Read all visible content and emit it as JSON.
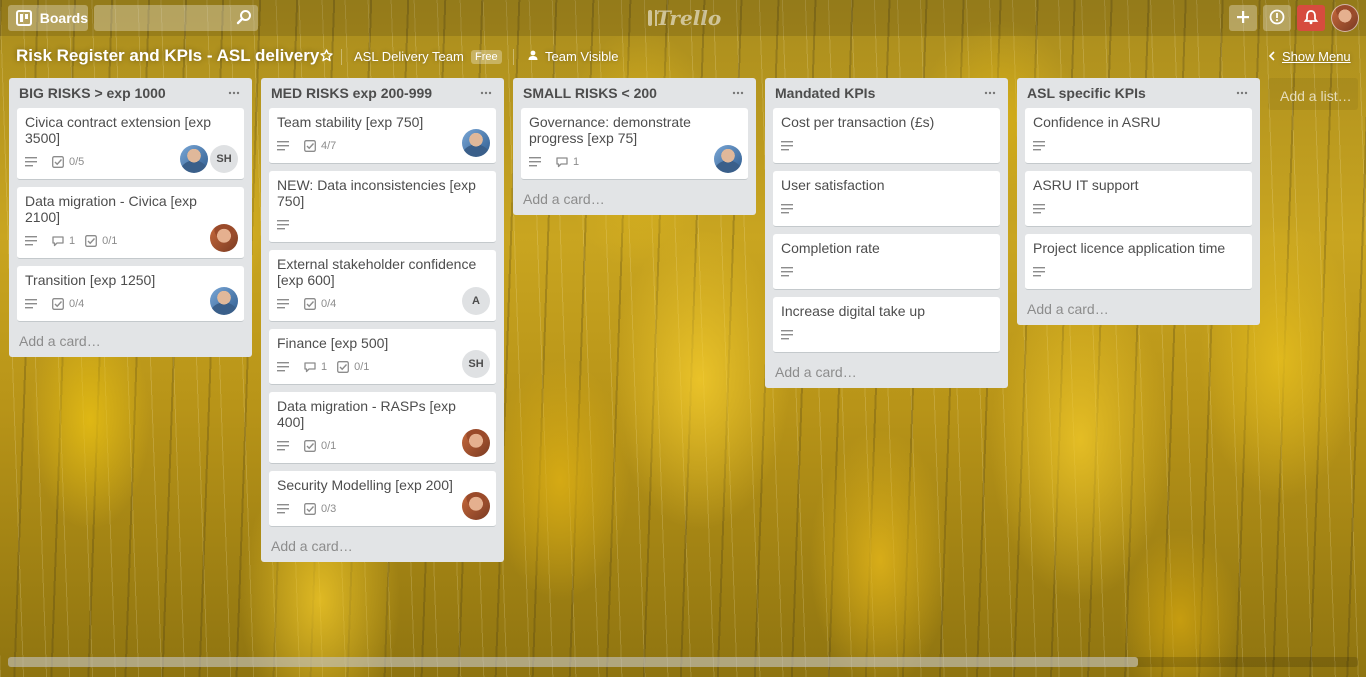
{
  "header": {
    "boards_label": "Boards",
    "logo_text": "Trello"
  },
  "board": {
    "title": "Risk Register and KPIs - ASL delivery",
    "team": "ASL Delivery Team",
    "team_badge": "Free",
    "visibility": "Team Visible",
    "show_menu": "Show Menu",
    "add_list": "Add a list…"
  },
  "lists": [
    {
      "title": "BIG RISKS > exp 1000",
      "add_card": "Add a card…",
      "cards": [
        {
          "title": "Civica contract extension [exp 3500]",
          "checklist": "0/5"
        },
        {
          "title": "Data migration - Civica [exp 2100]",
          "comments": "1",
          "checklist": "0/1"
        },
        {
          "title": "Transition [exp 1250]",
          "checklist": "0/4"
        }
      ]
    },
    {
      "title": "MED RISKS exp 200-999",
      "add_card": "Add a card…",
      "cards": [
        {
          "title": "Team stability [exp 750]",
          "checklist": "4/7"
        },
        {
          "title": "NEW: Data inconsistencies [exp 750]"
        },
        {
          "title": "External stakeholder confidence [exp 600]",
          "checklist": "0/4"
        },
        {
          "title": "Finance [exp 500]",
          "comments": "1",
          "checklist": "0/1"
        },
        {
          "title": "Data migration - RASPs [exp 400]",
          "checklist": "0/1"
        },
        {
          "title": "Security Modelling [exp 200]",
          "checklist": "0/3"
        }
      ]
    },
    {
      "title": "SMALL RISKS < 200",
      "add_card": "Add a card…",
      "cards": [
        {
          "title": "Governance: demonstrate progress [exp 75]",
          "comments": "1"
        }
      ]
    },
    {
      "title": "Mandated KPIs",
      "add_card": "Add a card…",
      "cards": [
        {
          "title": "Cost per transaction (£s)"
        },
        {
          "title": "User satisfaction"
        },
        {
          "title": "Completion rate"
        },
        {
          "title": "Increase digital take up"
        }
      ]
    },
    {
      "title": "ASL specific KPIs",
      "add_card": "Add a card…",
      "cards": [
        {
          "title": "Confidence in ASRU"
        },
        {
          "title": "ASRU IT support"
        },
        {
          "title": "Project licence application time"
        }
      ]
    }
  ],
  "members": {
    "initials_sh": "SH",
    "initials_a": "A"
  },
  "colors": {
    "notification": "#d64c3e",
    "list_bg": "#e2e4e6"
  }
}
